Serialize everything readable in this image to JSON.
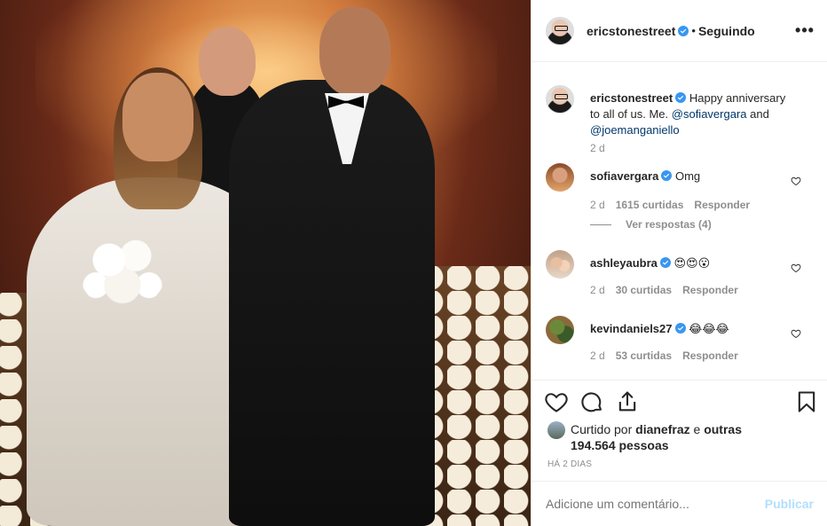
{
  "post": {
    "author": "ericstonestreet",
    "separator": "•",
    "following_label": "Seguindo",
    "more_label": "•••"
  },
  "caption": {
    "username": "ericstonestreet",
    "text_before": "Happy anniversary to all of us. Me. ",
    "mention1": "@sofiavergara",
    "text_mid": " and ",
    "mention2": "@joemanganiello",
    "time": "2 d"
  },
  "comments": [
    {
      "username": "sofiavergara",
      "verified": true,
      "text": "Omg",
      "time": "2 d",
      "likes": "1615 curtidas",
      "reply": "Responder",
      "view_replies": "Ver respostas (4)"
    },
    {
      "username": "ashleyaubra",
      "verified": true,
      "text": "😍😍😮",
      "time": "2 d",
      "likes": "30 curtidas",
      "reply": "Responder"
    },
    {
      "username": "kevindaniels27",
      "verified": true,
      "text": "😂😂😂",
      "time": "2 d",
      "likes": "53 curtidas",
      "reply": "Responder"
    }
  ],
  "likes": {
    "prefix": "Curtido por",
    "user": "dianefraz",
    "suffix": "e",
    "others": "outras 194.564 pessoas"
  },
  "posted_ago": "HÁ 2 DIAS",
  "add_comment": {
    "placeholder": "Adicione um comentário...",
    "publish": "Publicar"
  },
  "colors": {
    "verified": "#3897f0",
    "mention": "#00376b",
    "muted": "#8e8e8e",
    "publish_disabled": "#b2dffc"
  },
  "icons": [
    "heart-icon",
    "comment-icon",
    "share-icon",
    "bookmark-icon",
    "more-icon",
    "verified-icon"
  ]
}
